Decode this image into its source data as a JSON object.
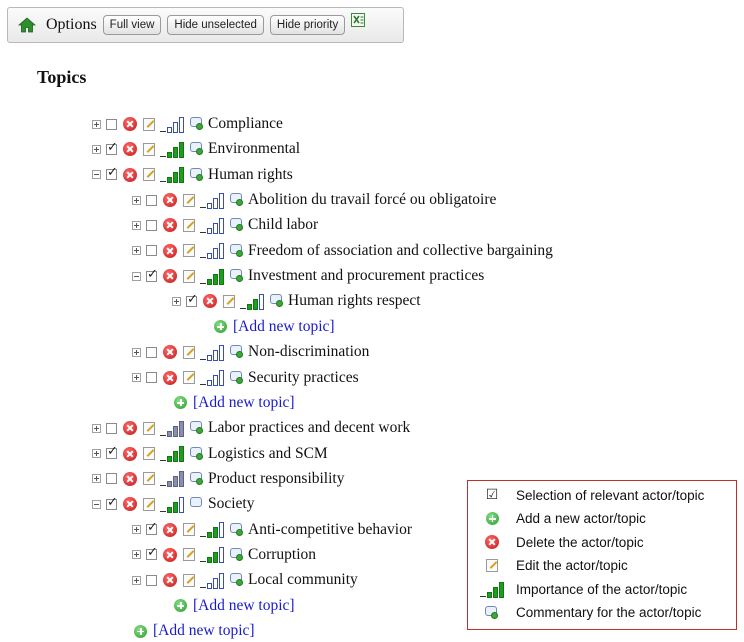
{
  "toolbar": {
    "options_label": "Options",
    "buttons": [
      "Full view",
      "Hide unselected",
      "Hide priority"
    ]
  },
  "topics_title": "Topics",
  "add_new_topic_label": "[Add new topic]",
  "colors": {
    "link": "#1a1acc",
    "selected_importance": "#1d9e1d",
    "legend_border": "#c0302a"
  },
  "tree": [
    {
      "type": "topic",
      "level": 0,
      "label": "Compliance",
      "checked": false,
      "importance": 0
    },
    {
      "type": "topic",
      "level": 0,
      "label": "Environmental",
      "checked": true,
      "importance": 3
    },
    {
      "type": "topic",
      "level": 0,
      "label": "Human rights",
      "checked": true,
      "importance": 3,
      "expanded": true
    },
    {
      "type": "topic",
      "level": 1,
      "label": "Abolition du travail forcé ou obligatoire",
      "checked": false,
      "importance": 0
    },
    {
      "type": "topic",
      "level": 1,
      "label": "Child labor",
      "checked": false,
      "importance": 0
    },
    {
      "type": "topic",
      "level": 1,
      "label": "Freedom of association and collective bargaining",
      "checked": false,
      "importance": 0
    },
    {
      "type": "topic",
      "level": 1,
      "label": "Investment and procurement practices",
      "checked": true,
      "importance": 3,
      "expanded": true
    },
    {
      "type": "topic",
      "level": 2,
      "label": "Human rights respect",
      "checked": true,
      "importance": 2
    },
    {
      "type": "add",
      "level": 2
    },
    {
      "type": "topic",
      "level": 1,
      "label": "Non-discrimination",
      "checked": false,
      "importance": 0
    },
    {
      "type": "topic",
      "level": 1,
      "label": "Security practices",
      "checked": false,
      "importance": 0
    },
    {
      "type": "add",
      "level": 1
    },
    {
      "type": "topic",
      "level": 0,
      "label": "Labor practices and decent work",
      "checked": false,
      "importance": 3,
      "muted": true
    },
    {
      "type": "topic",
      "level": 0,
      "label": "Logistics and SCM",
      "checked": true,
      "importance": 3
    },
    {
      "type": "topic",
      "level": 0,
      "label": "Product responsibility",
      "checked": false,
      "importance": 3,
      "muted": true
    },
    {
      "type": "topic",
      "level": 0,
      "label": "Society",
      "checked": true,
      "importance": 2,
      "expanded": true,
      "plain_comment": true
    },
    {
      "type": "topic",
      "level": 1,
      "label": "Anti-competitive behavior",
      "checked": true,
      "importance": 2
    },
    {
      "type": "topic",
      "level": 1,
      "label": "Corruption",
      "checked": true,
      "importance": 2
    },
    {
      "type": "topic",
      "level": 1,
      "label": "Local community",
      "checked": false,
      "importance": 0
    },
    {
      "type": "add",
      "level": 1
    },
    {
      "type": "add",
      "level": 0
    }
  ],
  "legend": [
    {
      "icon": "checkbox-icon",
      "text": "Selection of relevant actor/topic"
    },
    {
      "icon": "add-icon",
      "text": "Add a new actor/topic"
    },
    {
      "icon": "delete-icon",
      "text": "Delete the actor/topic"
    },
    {
      "icon": "edit-icon",
      "text": "Edit the actor/topic"
    },
    {
      "icon": "importance-icon",
      "text": "Importance of the actor/topic"
    },
    {
      "icon": "comment-icon",
      "text": "Commentary for the actor/topic"
    }
  ]
}
